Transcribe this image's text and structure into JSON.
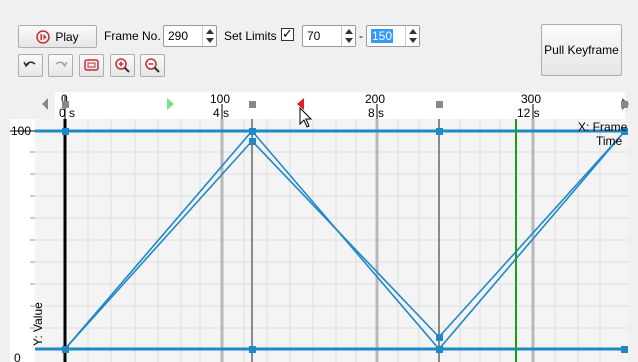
{
  "toolbar": {
    "play_label": "Play",
    "frame_no_label": "Frame No.",
    "frame_no_value": "290",
    "set_limits_label": "Set Limits",
    "set_limits_checked": "✓",
    "limit_start": "70",
    "limit_dash": "-",
    "limit_end": "150",
    "pull_keyframe_label": "Pull Keyframe"
  },
  "timeline": {
    "frame_ticks": [
      "0",
      "100",
      "200",
      "300"
    ],
    "time_ticks": [
      "0 s",
      "4 s",
      "8 s",
      "12 s"
    ]
  },
  "graph": {
    "y_max_label": "100",
    "y_min_label": "0",
    "x_axis_label_line1": "X: Frame",
    "x_axis_label_line2": "Time",
    "y_axis_label": "Y: Value"
  },
  "colors": {
    "curve": "#1e88c8",
    "current_frame": "#1aa01a",
    "limit_start_marker": "#7ddf7d",
    "limit_end_marker": "#e02020"
  },
  "icons": {
    "undo": "undo-icon",
    "redo": "redo-icon",
    "fit": "fit-view-icon",
    "zoom_in": "zoom-in-icon",
    "zoom_out": "zoom-out-icon"
  }
}
